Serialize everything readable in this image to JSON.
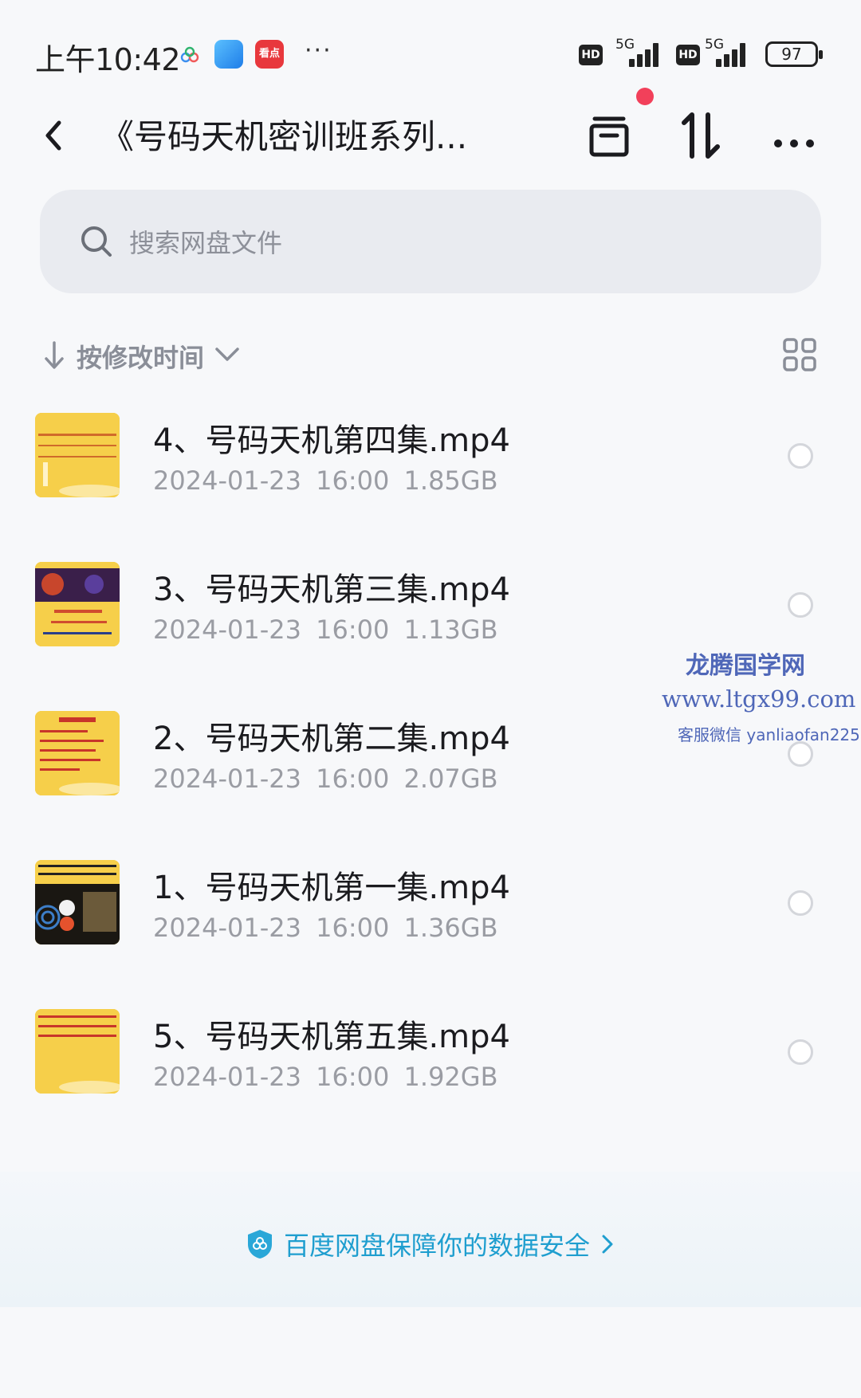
{
  "status_bar": {
    "time": "上午10:42",
    "app_badge_label": "看点",
    "more": "···",
    "hd_label": "HD",
    "network_1": "5G",
    "network_2": "5G",
    "battery": "97"
  },
  "header": {
    "title": "《号码天机密训班系列...",
    "has_notification": true
  },
  "search": {
    "placeholder": "搜索网盘文件"
  },
  "sort": {
    "label": "按修改时间"
  },
  "files": [
    {
      "name": "4、号码天机第四集.mp4",
      "date": "2024-01-23",
      "time": "16:00",
      "size": "1.85GB"
    },
    {
      "name": "3、号码天机第三集.mp4",
      "date": "2024-01-23",
      "time": "16:00",
      "size": "1.13GB"
    },
    {
      "name": "2、号码天机第二集.mp4",
      "date": "2024-01-23",
      "time": "16:00",
      "size": "2.07GB"
    },
    {
      "name": "1、号码天机第一集.mp4",
      "date": "2024-01-23",
      "time": "16:00",
      "size": "1.36GB"
    },
    {
      "name": "5、号码天机第五集.mp4",
      "date": "2024-01-23",
      "time": "16:00",
      "size": "1.92GB"
    }
  ],
  "watermark": {
    "line1": "龙腾国学网",
    "line2": "www.ltgx99.com",
    "line3": "客服微信 yanliaofan225"
  },
  "footer": {
    "safety_text": "百度网盘保障你的数据安全"
  },
  "colors": {
    "accent": "#1f9ecf",
    "notification": "#f2405a",
    "thumb_yellow": "#f3c63b"
  }
}
